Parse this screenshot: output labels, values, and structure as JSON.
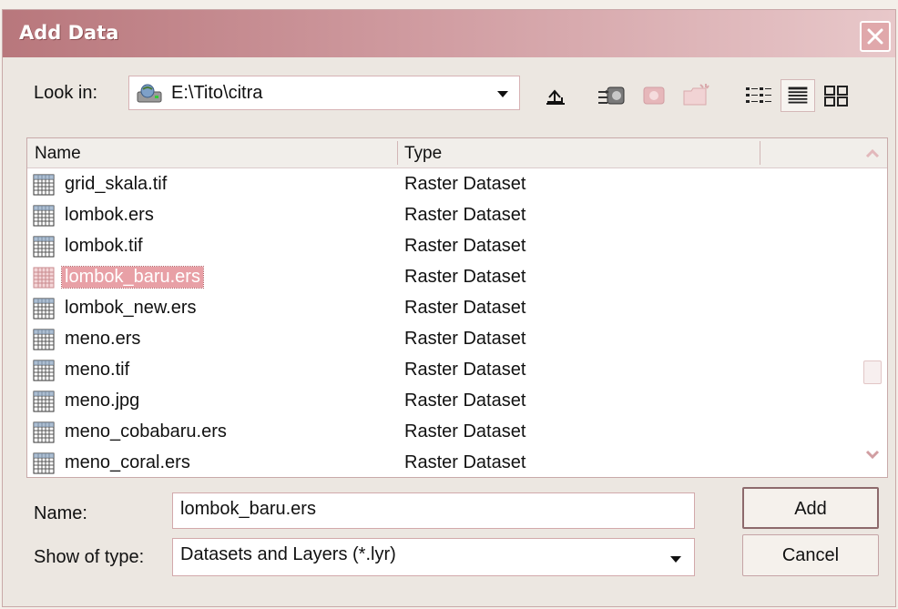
{
  "window": {
    "title": "Add Data"
  },
  "lookin": {
    "label": "Look in:",
    "path": "E:\\Tito\\citra"
  },
  "toolbar": {
    "icons": [
      "up-one-level-icon",
      "connect-folder-icon",
      "disconnect-folder-icon",
      "new-folder-icon",
      "list-view-icon",
      "details-view-icon",
      "thumbnails-view-icon"
    ]
  },
  "list": {
    "headers": {
      "name": "Name",
      "type": "Type"
    },
    "rows": [
      {
        "name": "grid_skala.tif",
        "type": "Raster Dataset"
      },
      {
        "name": "lombok.ers",
        "type": "Raster Dataset"
      },
      {
        "name": "lombok.tif",
        "type": "Raster Dataset"
      },
      {
        "name": "lombok_baru.ers",
        "type": "Raster Dataset",
        "selected": true
      },
      {
        "name": "lombok_new.ers",
        "type": "Raster Dataset"
      },
      {
        "name": "meno.ers",
        "type": "Raster Dataset"
      },
      {
        "name": "meno.tif",
        "type": "Raster Dataset"
      },
      {
        "name": "meno.jpg",
        "type": "Raster Dataset"
      },
      {
        "name": "meno_cobabaru.ers",
        "type": "Raster Dataset"
      },
      {
        "name": "meno_coral.ers",
        "type": "Raster Dataset"
      }
    ]
  },
  "name_field": {
    "label": "Name:",
    "value": "lombok_baru.ers"
  },
  "type_field": {
    "label": "Show of type:",
    "value": "Datasets and Layers (*.lyr)"
  },
  "buttons": {
    "add": "Add",
    "cancel": "Cancel"
  },
  "colors": {
    "titlebar": "#c48a8e",
    "selection": "#e8a0a6",
    "accent_border": "#d2a9ab"
  }
}
